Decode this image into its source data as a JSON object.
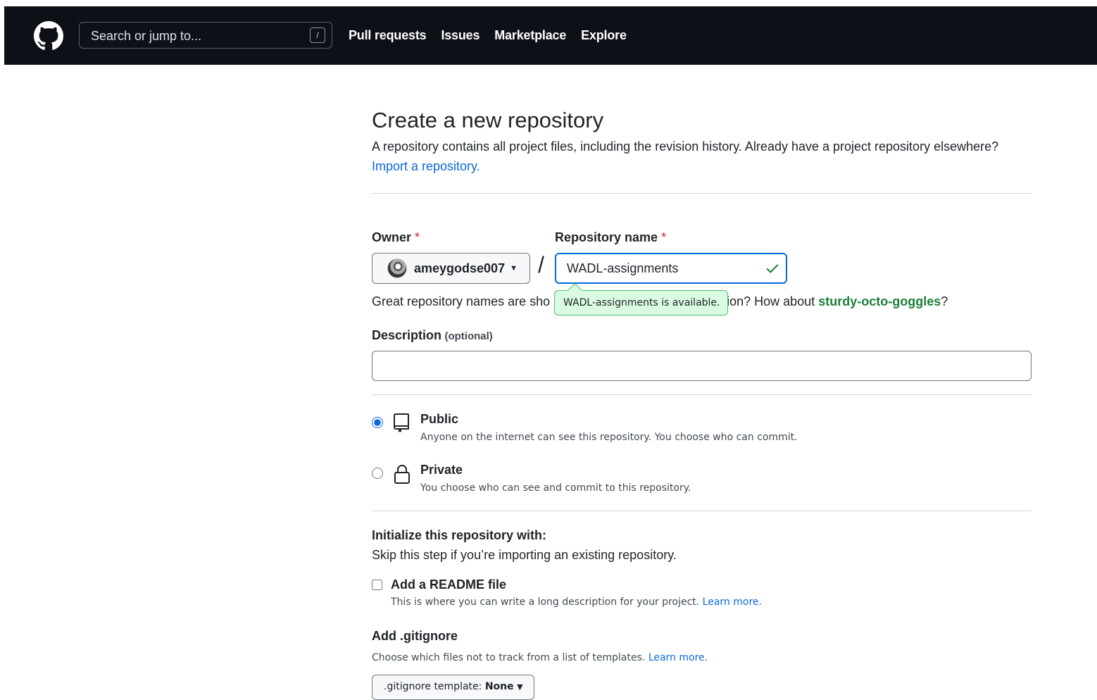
{
  "header": {
    "search_placeholder": "Search or jump to...",
    "search_shortcut": "/",
    "nav": {
      "pull_requests": "Pull requests",
      "issues": "Issues",
      "marketplace": "Marketplace",
      "explore": "Explore"
    }
  },
  "page": {
    "title": "Create a new repository",
    "subtitle": "A repository contains all project files, including the revision history. Already have a project repository elsewhere?",
    "import_link": "Import a repository."
  },
  "form": {
    "owner_label": "Owner",
    "repo_name_label": "Repository name",
    "required_mark": "*",
    "owner_value": "ameygodse007",
    "slash": "/",
    "repo_name_value": "WADL-assignments",
    "availability_tooltip": "WADL-assignments is available.",
    "name_hint_prefix": "Great repository names are sho",
    "name_hint_suffix": "ration? How about ",
    "name_suggestion": "sturdy-octo-goggles",
    "name_hint_end": "?",
    "description_label": "Description",
    "description_optional": "(optional)",
    "description_value": ""
  },
  "visibility": {
    "public_title": "Public",
    "public_desc": "Anyone on the internet can see this repository. You choose who can commit.",
    "private_title": "Private",
    "private_desc": "You choose who can see and commit to this repository.",
    "selected": "public"
  },
  "initialize": {
    "title": "Initialize this repository with:",
    "desc": "Skip this step if you’re importing an existing repository.",
    "readme_label": "Add a README file",
    "readme_desc": "This is where you can write a long description for your project.",
    "readme_learn_more": "Learn more.",
    "readme_checked": false
  },
  "gitignore": {
    "title": "Add .gitignore",
    "desc": "Choose which files not to track from a list of templates.",
    "learn_more": "Learn more.",
    "button_prefix": ".gitignore template:",
    "button_value": "None"
  },
  "colors": {
    "header_bg": "#0d1117",
    "link": "#0969da",
    "success_green": "#1a7f37",
    "tooltip_bg": "#dafbe1",
    "required_red": "#cf222e"
  },
  "icons": [
    "github-logo-icon",
    "check-icon",
    "repo-icon",
    "lock-icon",
    "caret-down-icon"
  ]
}
